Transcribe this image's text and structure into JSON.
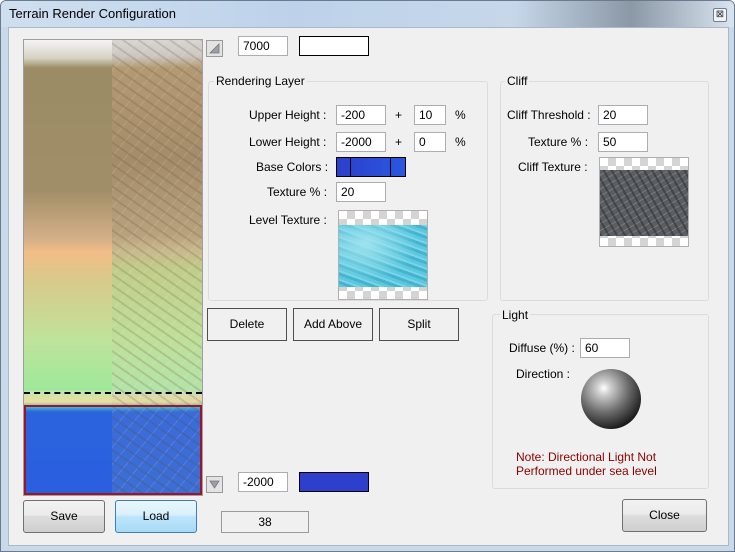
{
  "window": {
    "title": "Terrain Render Configuration",
    "close_glyph": "⊠"
  },
  "top": {
    "height_value": "7000",
    "color_hex": "#ffffff"
  },
  "rendering_layer": {
    "title": "Rendering Layer",
    "upper_height_label": "Upper Height :",
    "upper_height_value": "-200",
    "upper_plus": "+",
    "upper_percent_value": "10",
    "upper_percent_sign": "%",
    "lower_height_label": "Lower Height :",
    "lower_height_value": "-2000",
    "lower_plus": "+",
    "lower_percent_value": "0",
    "lower_percent_sign": "%",
    "base_colors_label": "Base Colors :",
    "texture_pct_label": "Texture % :",
    "texture_pct_value": "20",
    "level_texture_label": "Level Texture :"
  },
  "cliff": {
    "title": "Cliff",
    "threshold_label": "Cliff Threshold :",
    "threshold_value": "20",
    "texture_pct_label": "Texture % :",
    "texture_pct_value": "50",
    "texture_label": "Cliff Texture :"
  },
  "buttons": {
    "delete": "Delete",
    "add_above": "Add Above",
    "split": "Split",
    "save": "Save",
    "load": "Load",
    "close": "Close"
  },
  "light": {
    "title": "Light",
    "diffuse_label": "Diffuse (%) :",
    "diffuse_value": "60",
    "direction_label": "Direction :",
    "note": "Note: Directional Light Not Performed under sea level",
    "note_color": "#8b0000"
  },
  "bottom": {
    "height_value": "-2000",
    "color_hex": "#2d3fcc"
  },
  "status": {
    "value": "38"
  },
  "icons": {
    "up": "up-arrow-icon",
    "down": "down-arrow-icon"
  },
  "colors": {
    "accent_blue": "#2d3fcc",
    "selection_red": "#a0142a"
  }
}
